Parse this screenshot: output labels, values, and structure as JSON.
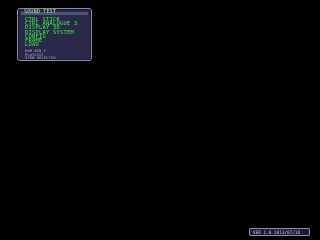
{
  "colors": {
    "background": "#000000",
    "panel_bg": "#29294a",
    "panel_border": "#8a8aa8",
    "menu_text": "#42f542",
    "title_text": "#9cff9c",
    "info_text": "#b4b4c8",
    "status_text": "#c8c8dc"
  },
  "menu": {
    "title": "SOUND TEST",
    "items": [
      {
        "label": "CTRL STICK"
      },
      {
        "label": "CTRL ANALOGUE 3"
      },
      {
        "label": "DISPLAY 3D"
      },
      {
        "label": "DISPLAY SYSTEM"
      },
      {
        "label": "CONFIG"
      },
      {
        "label": "FRAME"
      },
      {
        "label": "LOAD"
      }
    ],
    "info_lines": [
      "ROM BIN F",
      "PLAYLIST",
      "STRM SELECTED"
    ]
  },
  "status_bar": {
    "text": "VER 1.0 2013/07/18"
  }
}
